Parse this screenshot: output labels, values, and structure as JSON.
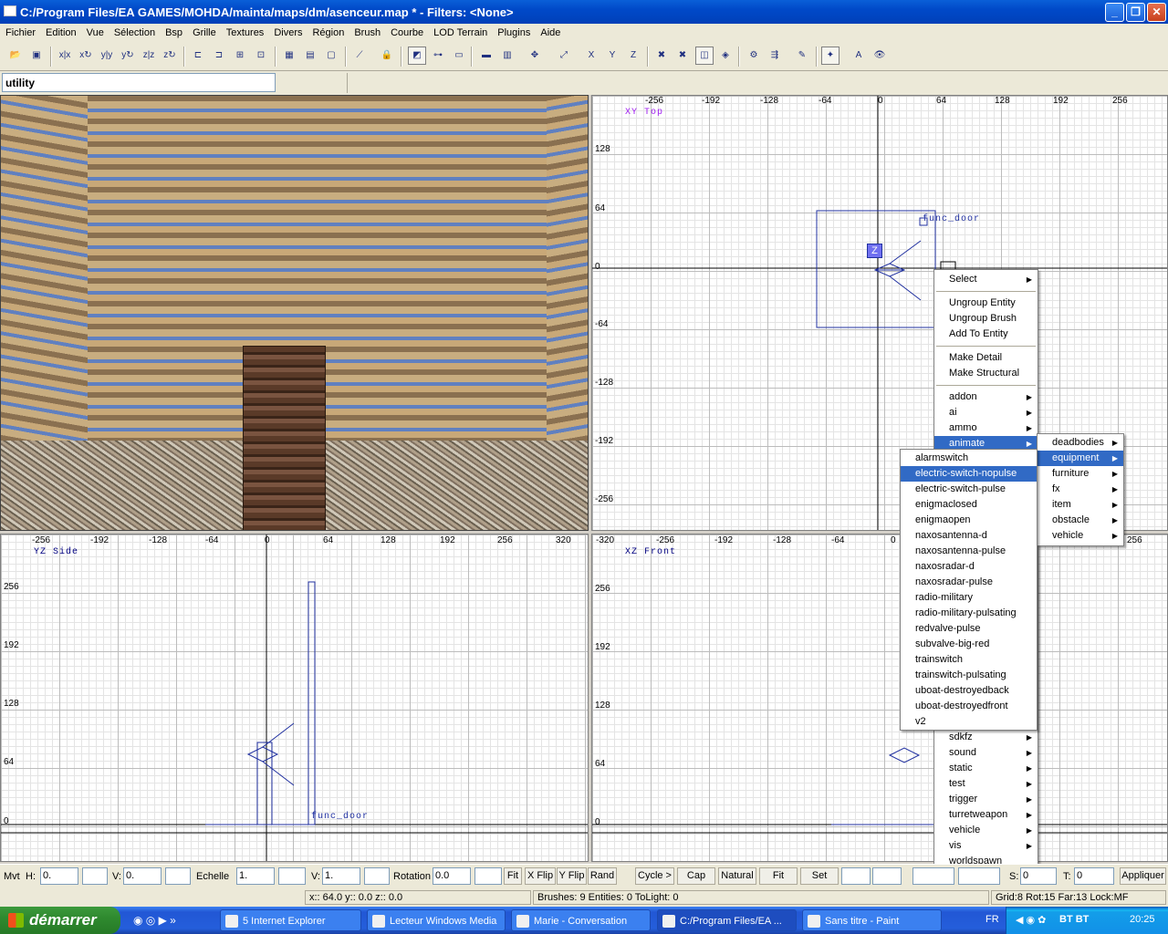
{
  "window": {
    "title": "C:/Program Files/EA GAMES/MOHDA/mainta/maps/dm/asenceur.map * - Filters: <None>"
  },
  "menu": [
    "Fichier",
    "Edition",
    "Vue",
    "Sélection",
    "Bsp",
    "Grille",
    "Textures",
    "Divers",
    "Région",
    "Brush",
    "Courbe",
    "LOD Terrain",
    "Plugins",
    "Aide"
  ],
  "entity_field": {
    "value": "utility"
  },
  "views": {
    "xy": {
      "label": "XY Top",
      "htick": [
        "-256",
        "-192",
        "-128",
        "-64",
        "0",
        "64",
        "128",
        "192",
        "256"
      ],
      "vtick": [
        "128",
        "64",
        "0",
        "-64",
        "-128",
        "-192",
        "-256"
      ],
      "entity": "func_door",
      "z_marker": "Z"
    },
    "yz": {
      "label": "YZ Side",
      "htick": [
        "-256",
        "-192",
        "-128",
        "-64",
        "0",
        "64",
        "128",
        "192",
        "256",
        "320"
      ],
      "vtick": [
        "256",
        "192",
        "128",
        "64",
        "0"
      ],
      "entity": "func_door"
    },
    "xz": {
      "label": "XZ Front",
      "htick": [
        "-320",
        "-256",
        "-192",
        "-128",
        "-64",
        "0"
      ],
      "vtick": [
        "256",
        "192",
        "128",
        "64",
        "0"
      ],
      "extra_htick": "256"
    }
  },
  "context_menu": {
    "top": [
      "Select"
    ],
    "group": [
      "Ungroup Entity",
      "Ungroup Brush",
      "Add To Entity"
    ],
    "struct": [
      "Make Detail",
      "Make Structural"
    ],
    "categories": [
      "addon",
      "ai",
      "ammo",
      "animate"
    ],
    "categories_lower": [
      "sdkfz",
      "sound",
      "static",
      "test",
      "trigger",
      "turretweapon",
      "vehicle",
      "vis",
      "worldspawn"
    ],
    "selected_category": "animate"
  },
  "submenu": {
    "items": [
      "deadbodies",
      "equipment",
      "furniture",
      "fx",
      "item",
      "obstacle",
      "vehicle"
    ],
    "selected": "equipment"
  },
  "submenu2": {
    "items": [
      "alarmswitch",
      "electric-switch-nopulse",
      "electric-switch-pulse",
      "enigmaclosed",
      "enigmaopen",
      "naxosantenna-d",
      "naxosantenna-pulse",
      "naxosradar-d",
      "naxosradar-pulse",
      "radio-military",
      "radio-military-pulsating",
      "redvalve-pulse",
      "subvalve-big-red",
      "trainswitch",
      "trainswitch-pulsating",
      "uboat-destroyedback",
      "uboat-destroyedfront",
      "v2"
    ],
    "selected": "electric-switch-nopulse"
  },
  "surface_bar": {
    "mvt_label": "Mvt",
    "h_label": "H:",
    "h_value": "0.",
    "v_label": "V:",
    "v_value": "0.",
    "echelle_label": "Echelle",
    "echelle_h": "1.",
    "echelle_v_label": "V:",
    "echelle_v": "1.",
    "rotation_label": "Rotation",
    "rotation_value": "0.0",
    "buttons": [
      "Fit",
      "X Flip",
      "Y Flip",
      "Rand",
      "Cycle >",
      "Cap",
      "Natural",
      "Fit",
      "Set"
    ],
    "s_label": "S:",
    "s_value": "0",
    "t_label": "T:",
    "t_value": "0",
    "apply": "Appliquer"
  },
  "status": {
    "coords": "x:: 64.0  y:: 0.0  z:: 0.0",
    "counts": "Brushes: 9 Entities: 0 ToLight: 0",
    "grid": "Grid:8 Rot:15 Far:13 Lock:MF"
  },
  "taskbar": {
    "start": "démarrer",
    "tasks": [
      "5 Internet Explorer",
      "Lecteur Windows Media",
      "Marie - Conversation",
      "C:/Program Files/EA ...",
      "Sans titre - Paint"
    ],
    "lang": "FR",
    "tray_text": "BT BT",
    "clock": "20:25"
  }
}
